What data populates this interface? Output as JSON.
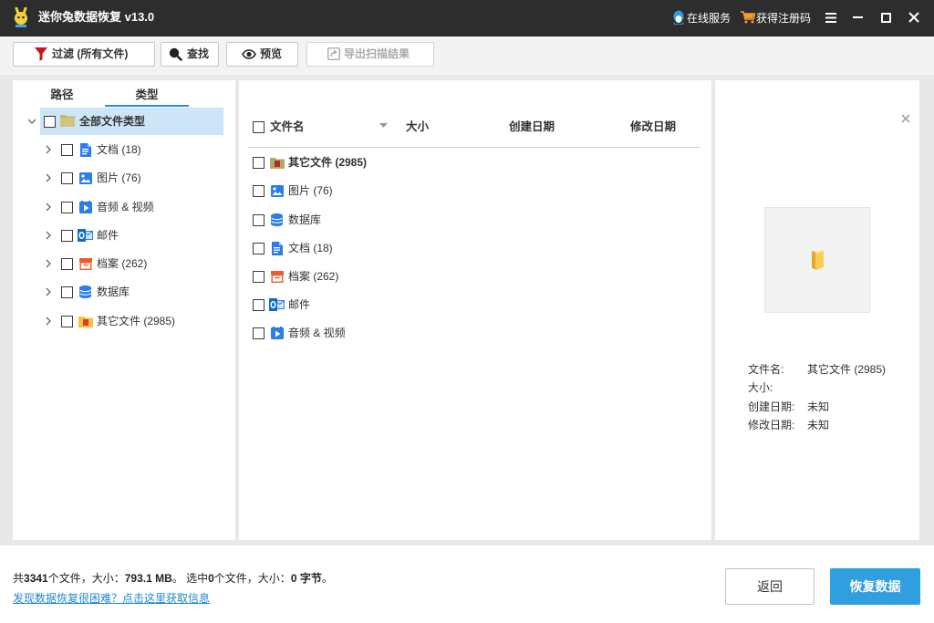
{
  "app": {
    "title": "迷你兔数据恢复 v13.0",
    "icon": "app-logo-icon"
  },
  "titlebar": {
    "online_service": {
      "label": "在线服务",
      "icon": "qq-icon"
    },
    "get_code": {
      "label": "获得注册码",
      "icon": "cart-icon"
    },
    "window_controls": [
      "menu-icon",
      "minimize-icon",
      "maximize-icon",
      "close-icon"
    ]
  },
  "toolbar": {
    "filter": {
      "label": "过滤 (所有文件)",
      "icon": "funnel-icon"
    },
    "find": {
      "label": "查找",
      "icon": "search-icon"
    },
    "preview": {
      "label": "预览",
      "icon": "eye-icon"
    },
    "export": {
      "label": "导出扫描结果",
      "icon": "export-icon",
      "enabled": false
    }
  },
  "left_panel": {
    "tabs": [
      {
        "label": "路径",
        "selected": false
      },
      {
        "label": "类型",
        "selected": true
      }
    ],
    "tree": {
      "root": {
        "label": "全部文件类型",
        "icon": "folder-icon",
        "expanded": true,
        "selected": true,
        "checked": false
      },
      "children": [
        {
          "label": "文档 (18)",
          "icon": "document-icon",
          "expanded": false,
          "checked": false
        },
        {
          "label": "图片 (76)",
          "icon": "image-icon",
          "expanded": false,
          "checked": false
        },
        {
          "label": "音频 & 视频",
          "icon": "video-icon",
          "expanded": false,
          "checked": false
        },
        {
          "label": "邮件",
          "icon": "mail-icon",
          "expanded": false,
          "checked": false
        },
        {
          "label": "档案 (262)",
          "icon": "archive-icon",
          "expanded": false,
          "checked": false
        },
        {
          "label": "数据库",
          "icon": "database-icon",
          "expanded": false,
          "checked": false
        },
        {
          "label": "其它文件 (2985)",
          "icon": "other-files-icon",
          "expanded": false,
          "checked": false
        }
      ]
    }
  },
  "file_list": {
    "columns": [
      "文件名",
      "大小",
      "创建日期",
      "修改日期"
    ],
    "sort_icon": "sort-down-icon",
    "rows": [
      {
        "name": "其它文件 (2985)",
        "icon": "other-files-icon",
        "checked": false
      },
      {
        "name": "图片 (76)",
        "icon": "image-icon",
        "checked": false
      },
      {
        "name": "数据库",
        "icon": "database-icon",
        "checked": false
      },
      {
        "name": "文档 (18)",
        "icon": "document-icon",
        "checked": false
      },
      {
        "name": "档案 (262)",
        "icon": "archive-icon",
        "checked": false
      },
      {
        "name": "邮件",
        "icon": "mail-icon",
        "checked": false
      },
      {
        "name": "音频 & 视频",
        "icon": "video-icon",
        "checked": false
      }
    ]
  },
  "preview_panel": {
    "close_icon": "close-icon",
    "thumbnail_icon": "folder-icon",
    "fields": [
      {
        "label": "文件名:",
        "value": "其它文件 (2985)"
      },
      {
        "label": "大小:"
      },
      {
        "label": "创建日期:",
        "value": "未知"
      },
      {
        "label": "修改日期:",
        "value": "未知"
      }
    ]
  },
  "status": {
    "summary": [
      "共",
      "3341",
      "个文件，大小：",
      "793.1 MB",
      "。 选中",
      "0",
      "个文件，大小：",
      "0 字节",
      "。"
    ],
    "help_link": "发现数据恢复很困难？点击这里获取信息"
  },
  "actions": {
    "back": "返回",
    "recover": "恢复数据"
  },
  "colors": {
    "titlebar": "#2d2d2d",
    "accent": "#2f9fe0",
    "selection": "#cde6f7",
    "link": "#1e88d4",
    "tab_underline": "#2f8ae0"
  }
}
